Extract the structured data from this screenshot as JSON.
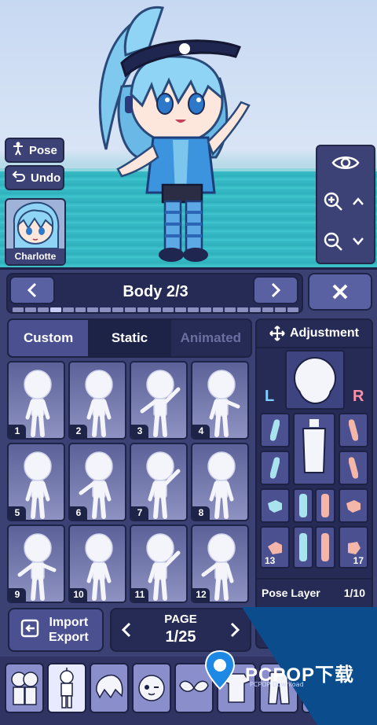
{
  "scene": {
    "pose_label": "Pose",
    "undo_label": "Undo",
    "character_name": "Charlotte"
  },
  "panel": {
    "title": "Body 2/3",
    "progress_total": 23,
    "progress_active_index": 3,
    "tabs": [
      {
        "label": "Custom"
      },
      {
        "label": "Static"
      },
      {
        "label": "Animated"
      }
    ],
    "poses": [
      "1",
      "2",
      "3",
      "4",
      "5",
      "6",
      "7",
      "8",
      "9",
      "10",
      "11",
      "12"
    ],
    "import_export": {
      "line1": "Import",
      "line2": "Export"
    },
    "page": {
      "label": "PAGE",
      "value": "1/25"
    },
    "adjustment": {
      "title": "Adjustment",
      "left_label": "L",
      "right_label": "R",
      "part_13": "13",
      "part_17": "17",
      "pose_layer_label": "Pose Layer",
      "pose_layer_value": "1/10"
    }
  },
  "watermark": {
    "brand": "PCPOP下载",
    "sub": "PCPOP Download"
  },
  "colors": {
    "panel": "#3b4173",
    "accent": "#5a61a3",
    "dark": "#262b55",
    "left": "#7fd1ff",
    "right": "#ff8fa6"
  }
}
